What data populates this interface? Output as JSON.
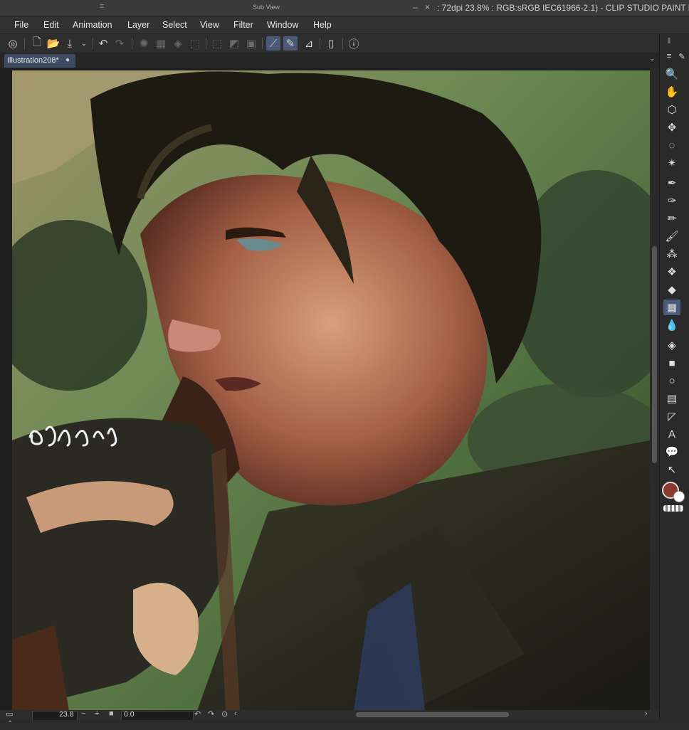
{
  "title_bar": {
    "sub_view": "Sub View",
    "info": ": 72dpi 23.8% : RGB:sRGB IEC61966-2.1)  - CLIP STUDIO PAINT PRO",
    "close_icon": "close-icon"
  },
  "menu": {
    "items": [
      "File",
      "Edit",
      "Animation",
      "Layer",
      "Select",
      "View",
      "Filter",
      "Window",
      "Help"
    ]
  },
  "tab": {
    "label": "Illustration208*",
    "close_glyph": "●"
  },
  "status": {
    "zoom": "23.8",
    "angle": "0.0"
  },
  "watermark": "@b.kiyidbsi",
  "colors": {
    "main_color": "#8a3a2e",
    "sub_color": "#ffffff",
    "accent": "#4a5a78"
  }
}
